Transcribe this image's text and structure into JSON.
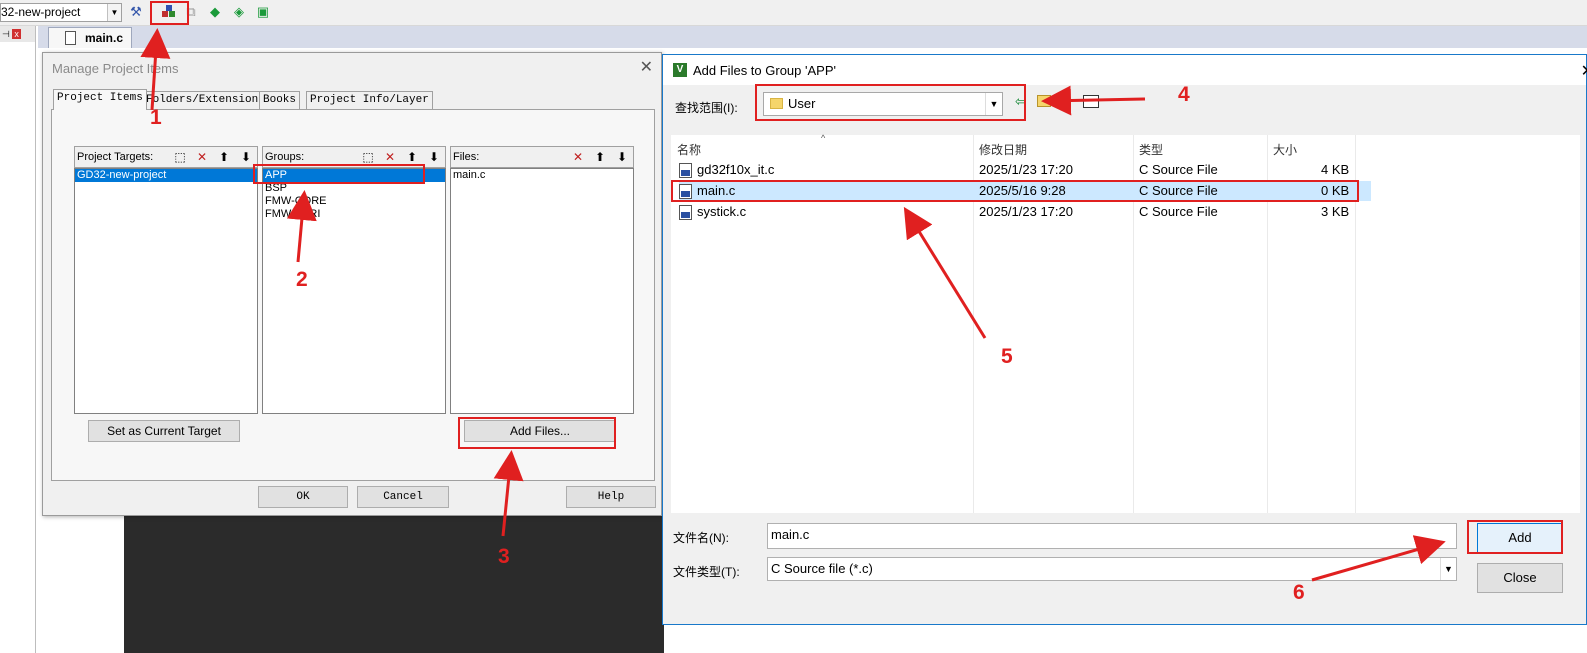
{
  "toolbar": {
    "target_value": "32-new-project",
    "icons": [
      "target-options-icon",
      "manage-project-items-icon",
      "batch-icon",
      "pack-installer-icon",
      "select-packs-icon",
      "run-time-env-icon"
    ]
  },
  "editor": {
    "tab_label": "main.c"
  },
  "manage_dialog": {
    "title": "Manage Project Items",
    "tabs": [
      "Project Items",
      "Folders/Extensions",
      "Books",
      "Project Info/Layer"
    ],
    "targets_header": "Project Targets:",
    "targets": [
      "GD32-new-project"
    ],
    "groups_header": "Groups:",
    "groups": [
      "APP",
      "BSP",
      "FMW-CORE",
      "FMW-PERI"
    ],
    "files_header": "Files:",
    "files": [
      "main.c"
    ],
    "set_target_button": "Set as Current Target",
    "add_files_button": "Add Files...",
    "ok_button": "OK",
    "cancel_button": "Cancel",
    "help_button": "Help"
  },
  "add_files_dialog": {
    "title": "Add Files to Group 'APP'",
    "look_in_label": "查找范围(I):",
    "look_in_value": "User",
    "columns": [
      "名称",
      "修改日期",
      "类型",
      "大小"
    ],
    "files": [
      {
        "name": "gd32f10x_it.c",
        "date": "2025/1/23 17:20",
        "type": "C Source File",
        "size": "4 KB",
        "selected": false
      },
      {
        "name": "main.c",
        "date": "2025/5/16 9:28",
        "type": "C Source File",
        "size": "0 KB",
        "selected": true
      },
      {
        "name": "systick.c",
        "date": "2025/1/23 17:20",
        "type": "C Source File",
        "size": "3 KB",
        "selected": false
      }
    ],
    "filename_label": "文件名(N):",
    "filename_value": "main.c",
    "filetype_label": "文件类型(T):",
    "filetype_value": "C Source file (*.c)",
    "add_button": "Add",
    "close_button": "Close"
  },
  "annotations": [
    "1",
    "2",
    "3",
    "4",
    "5",
    "6"
  ],
  "colors": {
    "annotation": "#e02020",
    "selection": "#0078d7",
    "row_highlight": "#cce8ff"
  }
}
